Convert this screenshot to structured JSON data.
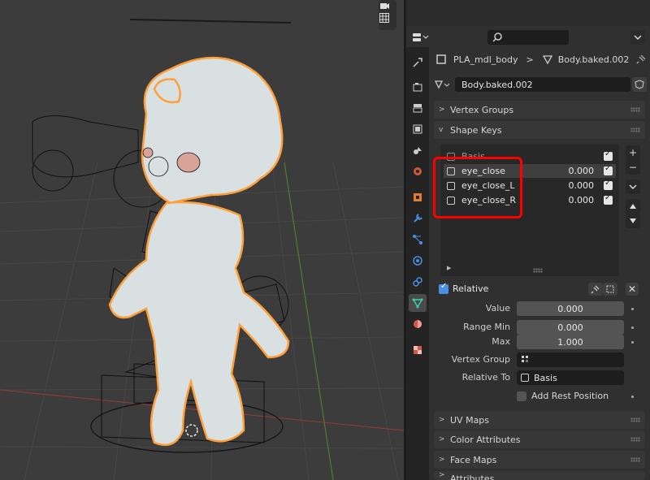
{
  "viewport": {
    "tool_icons": [
      "camera-icon",
      "grid-icon"
    ]
  },
  "topbar": {
    "editor_type_icon": "properties-editor-icon",
    "search_icon": "search-icon",
    "search_placeholder": ""
  },
  "breadcrumb": {
    "object": "PLA_mdl_body",
    "separator": ">",
    "mesh": "Body.baked.002"
  },
  "datablock": {
    "name": "Body.baked.002"
  },
  "panels": {
    "vertex_groups": "Vertex Groups",
    "shape_keys": "Shape Keys",
    "uv_maps": "UV Maps",
    "color_attributes": "Color Attributes",
    "face_maps": "Face Maps",
    "attributes": "Attributes"
  },
  "shape_keys": [
    {
      "name": "Basis",
      "value": "",
      "enabled": true,
      "selected": false
    },
    {
      "name": "eye_close",
      "value": "0.000",
      "enabled": true,
      "selected": true
    },
    {
      "name": "eye_close_L",
      "value": "0.000",
      "enabled": true,
      "selected": false
    },
    {
      "name": "eye_close_R",
      "value": "0.000",
      "enabled": true,
      "selected": false
    }
  ],
  "relative": {
    "label": "Relative",
    "checked": true
  },
  "props": {
    "value_label": "Value",
    "value": "0.000",
    "range_min_label": "Range Min",
    "range_min": "0.000",
    "max_label": "Max",
    "max": "1.000",
    "vertex_group_label": "Vertex Group",
    "vertex_group_value": "",
    "relative_to_label": "Relative To",
    "relative_to_value": "Basis",
    "add_rest_label": "Add Rest Position",
    "add_rest_checked": false
  },
  "colors": {
    "highlight": "#ff0000",
    "selection_outline": "#ff9f3a",
    "model": "#d8e0e2"
  }
}
